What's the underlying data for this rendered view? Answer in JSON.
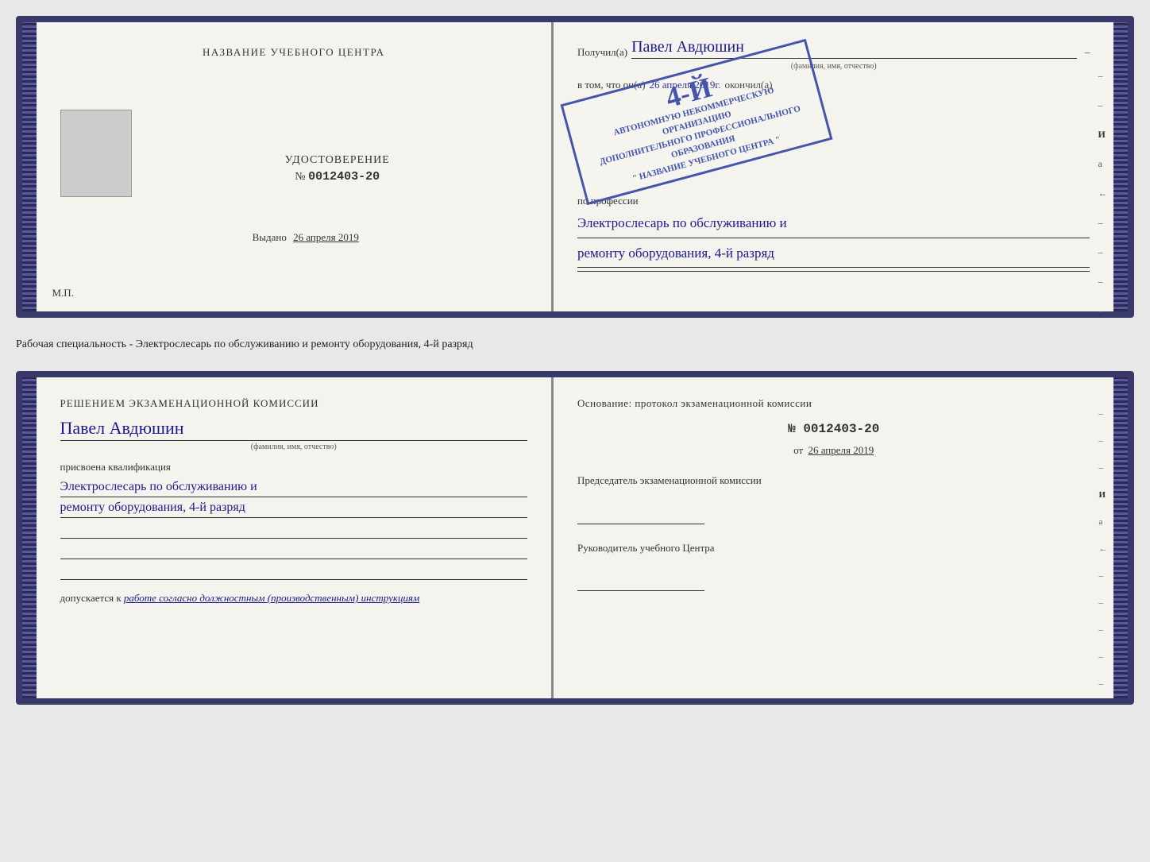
{
  "top_document": {
    "left": {
      "center_title": "НАЗВАНИЕ УЧЕБНОГО ЦЕНТРА",
      "udostoverenie_label": "УДОСТОВЕРЕНИЕ",
      "number_prefix": "№",
      "number": "0012403-20",
      "vydano_label": "Выдано",
      "vydano_date": "26 апреля 2019",
      "mp_label": "М.П."
    },
    "right": {
      "poluchil_label": "Получил(a)",
      "name": "Павел Авдюшин",
      "name_subtitle": "(фамилия, имя, отчество)",
      "vtom_label": "в том, что он(а)",
      "date_handwritten": "26 апреля 2019г.",
      "okonchil_label": "окончил(а)",
      "stamp_line1": "4-Й",
      "stamp_line2": "АВТОНОМНУЮ НЕКОММЕРЧЕСКУЮ ОРГАНИЗАЦИЮ",
      "stamp_line3": "ДОПОЛНИТЕЛЬНОГО ПРОФЕССИОНАЛЬНОГО ОБРАЗОВАНИЯ",
      "stamp_line4": "\" НАЗВАНИЕ УЧЕБНОГО ЦЕНТРА \"",
      "po_professii_label": "по профессии",
      "profession_line1": "Электрослесарь по обслуживанию и",
      "profession_line2": "ремонту оборудования, 4-й разряд"
    }
  },
  "middle_text": "Рабочая специальность - Электрослесарь по обслуживанию и ремонту оборудования, 4-й разряд",
  "bottom_document": {
    "left": {
      "resheniem_label": "Решением экзаменационной комиссии",
      "name": "Павел Авдюшин",
      "name_subtitle": "(фамилия, имя, отчество)",
      "prisvoena_label": "присвоена квалификация",
      "profession_line1": "Электрослесарь по обслуживанию и",
      "profession_line2": "ремонту оборудования, 4-й разряд",
      "dopuskaetsya_label": "допускается к",
      "dopuskaetsya_text": "работе согласно должностным (производственным) инструкциям"
    },
    "right": {
      "osnovanie_label": "Основание: протокол экзаменационной комиссии",
      "number_prefix": "№",
      "number": "0012403-20",
      "ot_prefix": "от",
      "ot_date": "26 апреля 2019",
      "predsedatel_label": "Председатель экзаменационной комиссии",
      "rukovoditel_label": "Руководитель учебного Центра"
    }
  },
  "decorative": {
    "dash": "–",
    "i_letter": "И",
    "ya_letter": "а",
    "left_arrow": "←",
    "minus": "–"
  }
}
